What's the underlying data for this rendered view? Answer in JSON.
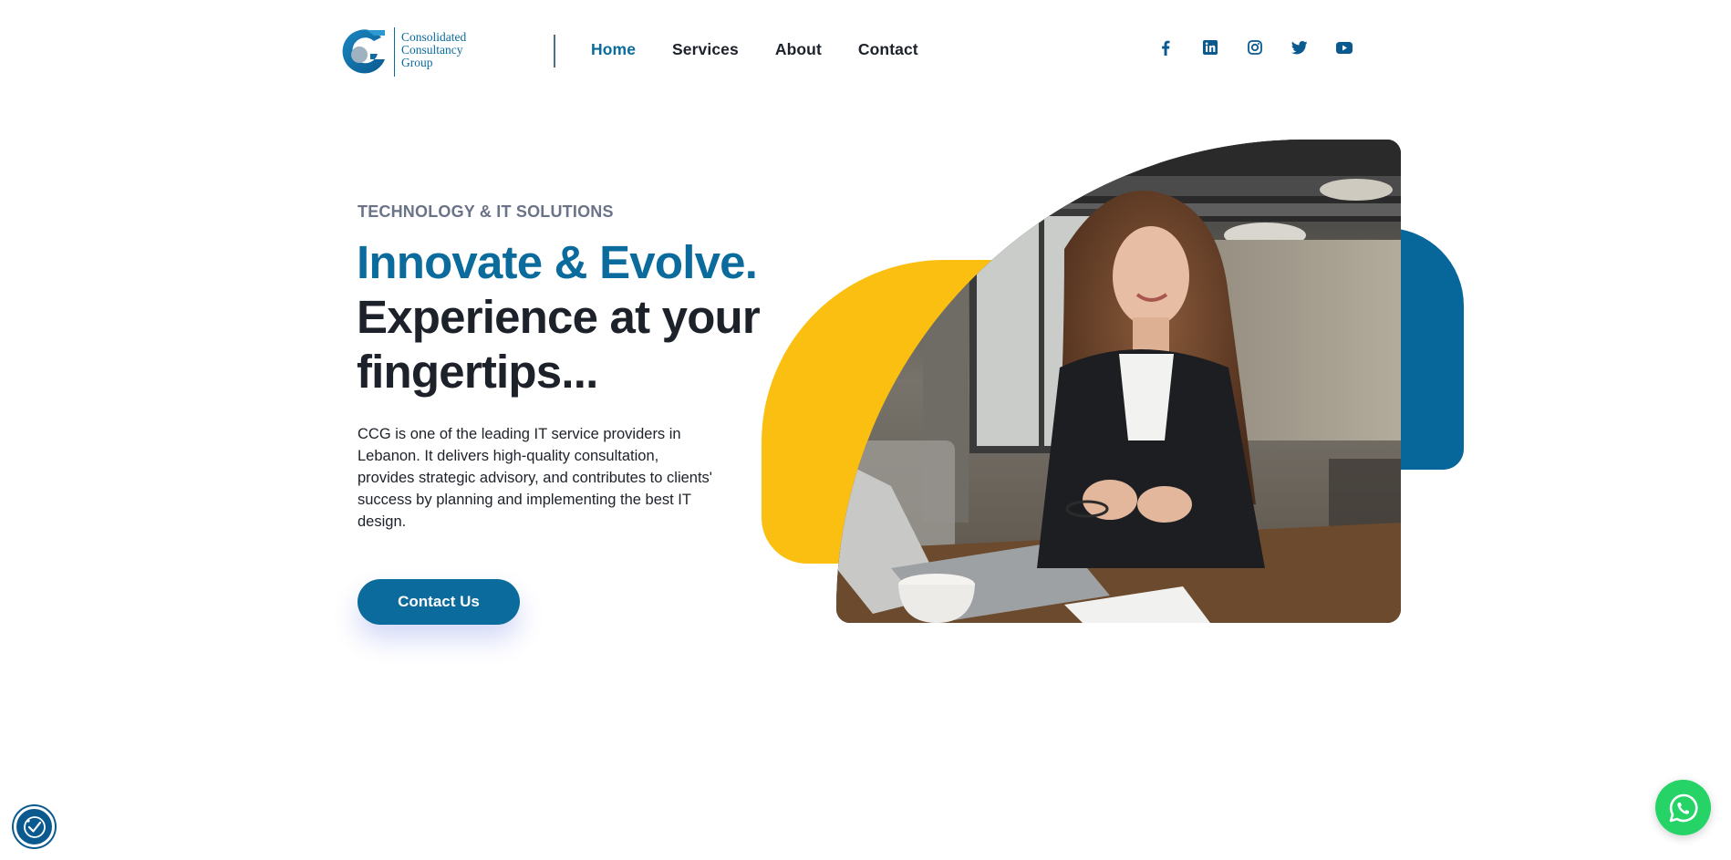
{
  "brand": {
    "line1": "Consolidated",
    "line2": "Consultancy",
    "line3": "Group",
    "primary_color": "#0a6b9c",
    "accent_color": "#fbbf12",
    "logo_icon": "g-logo-icon"
  },
  "nav": {
    "items": [
      {
        "label": "Home",
        "active": true
      },
      {
        "label": "Services",
        "active": false
      },
      {
        "label": "About",
        "active": false
      },
      {
        "label": "Contact",
        "active": false
      }
    ]
  },
  "social": {
    "icons": [
      "facebook-icon",
      "linkedin-icon",
      "instagram-icon",
      "twitter-icon",
      "youtube-icon"
    ]
  },
  "hero": {
    "eyebrow": "TECHNOLOGY & IT SOLUTIONS",
    "headline_accent": "Innovate & Evolve.",
    "headline_line2": "Experience at your",
    "headline_line3": "fingertips...",
    "description": "CCG is one of the leading IT service providers in Lebanon. It delivers high-quality consultation, provides strategic advisory, and contributes to clients' success by planning and implementing the best IT design.",
    "cta_label": "Contact Us",
    "image_icon": "businesswoman-photo"
  },
  "widgets": {
    "accessibility_icon": "accessibility-icon",
    "whatsapp_icon": "whatsapp-icon"
  }
}
